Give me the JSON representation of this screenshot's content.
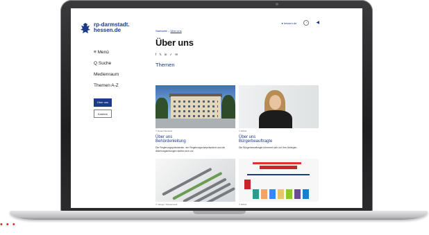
{
  "site": {
    "logo_line1": "rp-darmstadt.",
    "logo_line2": "hessen.de",
    "topbar": {
      "domain_link": "● hessen.de"
    }
  },
  "navigation": {
    "menu_label": "≡ Menü",
    "search_label": "Q Suche",
    "items": [
      "Medienraum",
      "Themen A-Z"
    ],
    "buttons": [
      "Über uns",
      "Karriere"
    ]
  },
  "breadcrumb": {
    "home": "Startseite",
    "separator": "–",
    "current": "Über uns"
  },
  "page": {
    "title": "Über uns",
    "section_title": "Themen"
  },
  "share_icons": [
    "f",
    "𝕏",
    "in",
    "✓",
    "✉"
  ],
  "cards": [
    {
      "credit": "© Daniel Werbeck",
      "kicker": "Über uns",
      "title": "Behördenleitung",
      "description": "Die Regierungspräsidentin, der Regierungsvizepräsident und die Abteilungsleitungen stellen sich vor."
    },
    {
      "credit": "© RPDA",
      "kicker": "Über uns",
      "title": "Bürgerbeauftragte",
      "description": "Die Bürgerbeauftragte kümmert sich um Ihre Anliegen."
    },
    {
      "credit": "© mdrigo / Shutterstock"
    },
    {
      "credit": "© RPDA"
    }
  ],
  "colors": {
    "brand_blue": "#1b3a8a",
    "accent_red": "#d6281a",
    "laptop_bezel": "#1f1f21"
  },
  "icons": {
    "top_round": "user-icon",
    "top_square": "speaker-icon"
  }
}
